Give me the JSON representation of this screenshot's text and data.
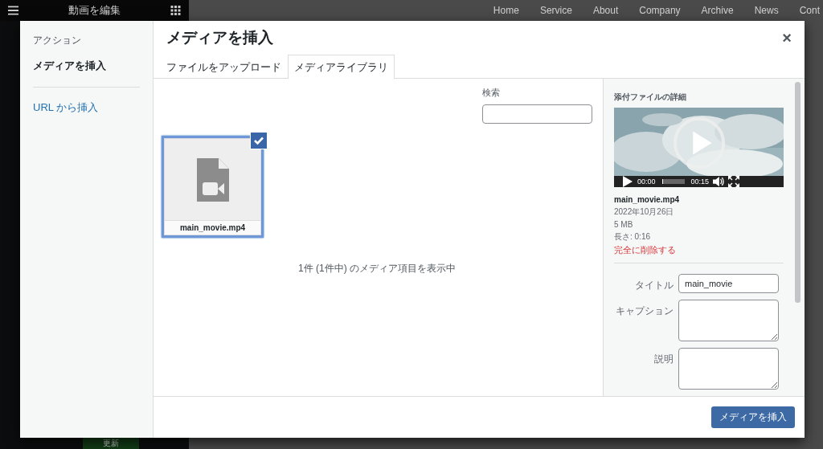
{
  "background": {
    "panel_title": "動画を編集",
    "nav": [
      "Home",
      "Service",
      "About",
      "Company",
      "Archive",
      "News",
      "Cont"
    ],
    "update_button": "更新"
  },
  "modal": {
    "menu_heading": "アクション",
    "menu": [
      {
        "label": "メディアを挿入",
        "selected": true
      },
      {
        "label": "URL から挿入",
        "selected": false
      }
    ],
    "title": "メディアを挿入",
    "close": "×",
    "tabs": [
      {
        "label": "ファイルをアップロード",
        "selected": false
      },
      {
        "label": "メディアライブラリ",
        "selected": true
      }
    ],
    "search_label": "検索",
    "items": [
      {
        "filename": "main_movie.mp4",
        "selected": true
      }
    ],
    "count_text": "1件 (1件中) のメディア項目を表示中",
    "details": {
      "heading": "添付ファイルの詳細",
      "video": {
        "current": "00:00",
        "duration": "00:15",
        "level": 0.05
      },
      "filename": "main_movie.mp4",
      "date": "2022年10月26日",
      "size": "5 MB",
      "length": "長さ: 0:16",
      "delete_link": "完全に削除する",
      "fields": [
        {
          "label": "タイトル",
          "value": "main_movie",
          "kind": "input"
        },
        {
          "label": "キャプション",
          "kind": "textarea"
        },
        {
          "label": "説明",
          "kind": "textarea"
        }
      ]
    },
    "insert_button": "メディアを挿入"
  }
}
